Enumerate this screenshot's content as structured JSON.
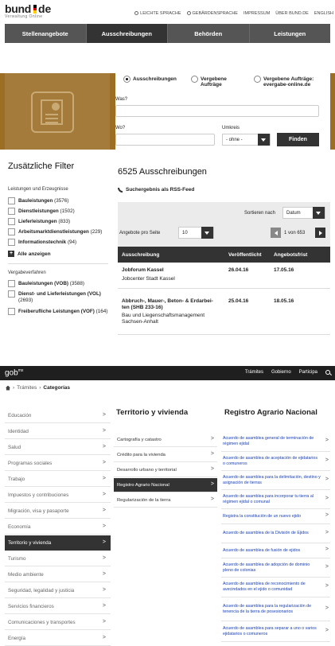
{
  "bund": {
    "logo": {
      "word": "bund",
      "suffix": "de",
      "subtitle": "Verwaltung Online",
      "flag_colors": [
        "#000000",
        "#dd0000",
        "#ffce00"
      ]
    },
    "meta_links": [
      "LEICHTE SPRACHE",
      "GEBÄRDENSPRACHE",
      "IMPRESSUM",
      "ÜBER BUND.DE",
      "ENGLISH"
    ],
    "nav": [
      "Stellenangebote",
      "Ausschreibungen",
      "Behörden",
      "Leistungen"
    ],
    "nav_active": "Ausschreibungen",
    "search": {
      "radios": [
        {
          "label": "Ausschreibungen",
          "checked": true
        },
        {
          "label": "Vergebene Aufträge",
          "checked": false
        },
        {
          "label": "Vergebene Aufträge: evergabe-online.de",
          "checked": false
        }
      ],
      "was_label": "Was?",
      "wo_label": "Wo?",
      "umkreis_label": "Umkreis",
      "umkreis_value": "- ohne -",
      "find_button": "Finden"
    },
    "filters": {
      "title": "Zusätzliche Filter",
      "group1_title": "Leistungen und Erzeugnisse",
      "group1": [
        {
          "label": "Bauleistungen",
          "count": "(3576)"
        },
        {
          "label": "Dienstleistungen",
          "count": "(1502)"
        },
        {
          "label": "Lieferleistungen",
          "count": "(833)"
        },
        {
          "label": "Arbeitsmarktdienstleistungen",
          "count": "(229)"
        },
        {
          "label": "Informationstechnik",
          "count": "(94)"
        }
      ],
      "show_all": "Alle anzeigen",
      "group2_title": "Vergabeverfahren",
      "group2": [
        {
          "label": "Bauleistungen (VOB)",
          "count": "(3588)"
        },
        {
          "label": "Dienst- und Lieferleistungen (VOL)",
          "count": "(2693)"
        },
        {
          "label": "Freiberufliche Leistungen (VOF)",
          "count": "(164)"
        }
      ]
    },
    "results": {
      "title": "6525 Ausschreibungen",
      "rss": "Suchergebnis als RSS-Feed",
      "sort_label": "Sortieren nach",
      "sort_value": "Datum",
      "per_page_label": "Angebote pro Seite",
      "per_page_value": "10",
      "page_info": "1 von 653",
      "columns": [
        "Ausschreibung",
        "Veröffentlicht",
        "Angebotsfrist"
      ],
      "rows": [
        {
          "title": "Jobforum Kassel",
          "org": "Jobcenter Stadt Kassel",
          "published": "26.04.16",
          "deadline": "17.05.16"
        },
        {
          "title": "Abbruch-, Mauer-, Beton- & Erdarbei- ten (SHB 233-16)",
          "org": "Bau und Liegenschaftsmanagement Sachsen-Anhalt",
          "published": "25.04.16",
          "deadline": "18.05.16"
        }
      ]
    }
  },
  "gob": {
    "logo": "gob",
    "logo_sup": "mx",
    "menu": [
      "Trámites",
      "Gobierno",
      "Participa"
    ],
    "breadcrumb": {
      "link": "Trámites",
      "current": "Categorías"
    },
    "categories": [
      "Educación",
      "Identidad",
      "Salud",
      "Programas sociales",
      "Trabajo",
      "Impuestos y contribuciones",
      "Migración, visa y pasaporte",
      "Economía",
      "Territorio y vivienda",
      "Turismo",
      "Medio ambiente",
      "Seguridad, legalidad y justicia",
      "Servicios financieros",
      "Comunicaciones y transportes",
      "Energía"
    ],
    "active_category": "Territorio y vivienda",
    "subcategory_title": "Territorio y vivienda",
    "subcategories": [
      "Cartografía y catastro",
      "Crédito para la vivienda",
      "Desarrollo urbano y territorial",
      "Registro Agrario Nacional",
      "Regularización de la tierra"
    ],
    "active_subcategory": "Registro Agrario Nacional",
    "procedures_title": "Registro Agrario Nacional",
    "procedures": [
      "Acuerdo de asamblea general de terminación de régimen ejidal",
      "Acuerdo de asamblea de aceptación de ejidatarios o comuneros",
      "Acuerdo de asamblea para la delimitación, destino y asignación de tierras",
      "Acuerdo de asamblea para incorporar tu tierra al régimen ejidal o comunal",
      "Registra la constitución de un nuevo ejido",
      "Acuerdo de asamblea de la División de Ejidos",
      "Acuerdo de asamblea de fusión de ejidos",
      "Acuerdo de asamblea de adopción de dominio pleno de colonias",
      "Acuerdo de asamblea de reconocimiento de avecindados en el ejido o comunidad",
      "Acuerdo de asamblea para la regularización de tenencia de la tierra de posesionarios",
      "Acuerdo de asamblea para separar a uno o varios ejidatarios o comuneros"
    ],
    "link_color": "#1a3fb5"
  }
}
